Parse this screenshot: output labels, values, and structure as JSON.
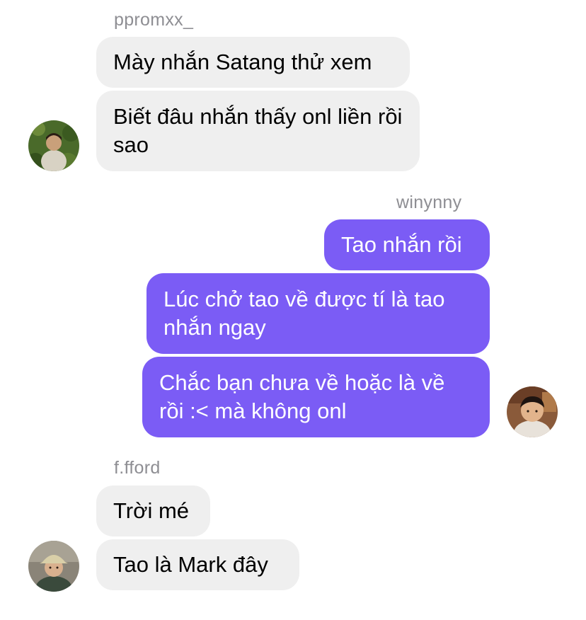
{
  "groups": [
    {
      "sender": "ppromxx_",
      "avatar": "avatar-ppromxx",
      "messages": [
        "Mày nhắn Satang thử xem",
        "Biết đâu nhắn thấy onl liền rồi sao"
      ]
    },
    {
      "sender": "winynny",
      "avatar": "avatar-winynny",
      "messages": [
        "Tao nhắn rồi",
        "Lúc chở tao về được tí là tao nhắn ngay",
        "Chắc bạn chưa về hoặc là về rồi :< mà không onl"
      ]
    },
    {
      "sender": "f.fford",
      "avatar": "avatar-ffford",
      "messages": [
        "Trời mé",
        "Tao là Mark đây"
      ]
    }
  ],
  "colors": {
    "incoming_bubble": "#efefef",
    "outgoing_bubble": "#7b5cf5",
    "sender_name": "#8e8e93"
  }
}
